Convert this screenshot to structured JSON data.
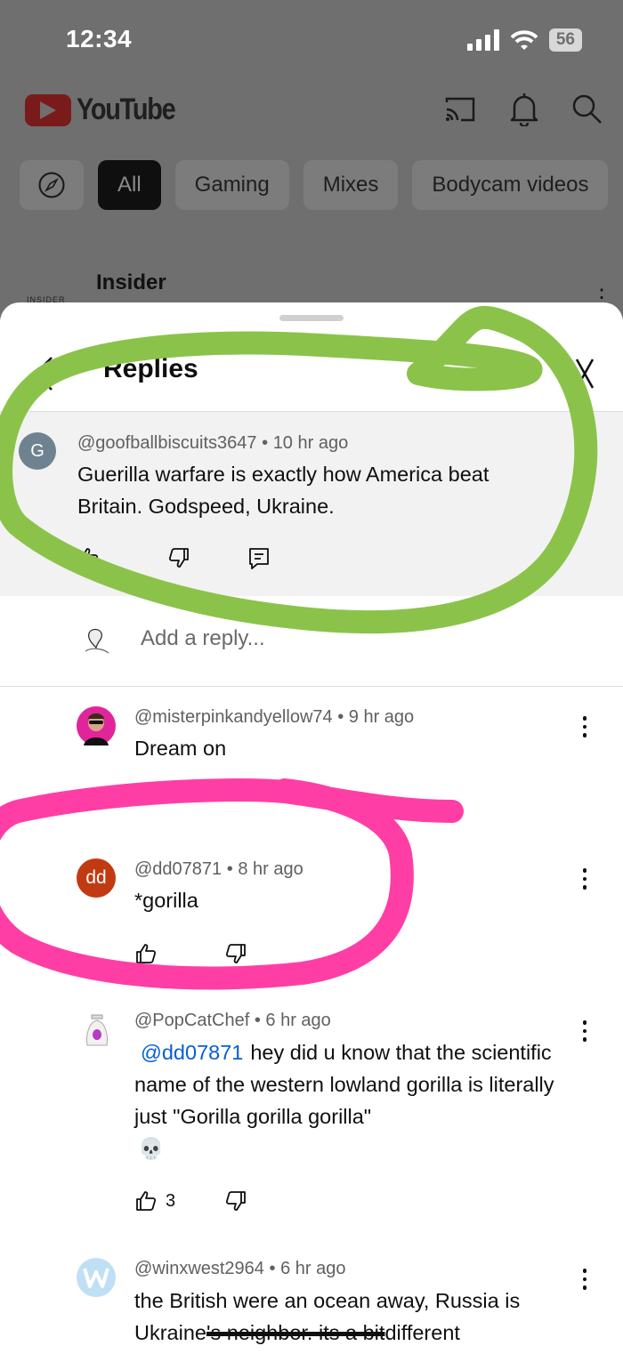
{
  "status": {
    "time": "12:34",
    "battery": "56"
  },
  "app": {
    "logo_text": "YouTube",
    "chips": [
      "All",
      "Gaming",
      "Mixes",
      "Bodycam videos"
    ],
    "video_channel": "Insider",
    "channel_logo_text": "INSIDER"
  },
  "sheet": {
    "title": "Replies",
    "add_reply_placeholder": "Add a reply..."
  },
  "parent_comment": {
    "avatar_letter": "G",
    "author": "@goofballbiscuits3647",
    "age": "10 hr ago",
    "text": "Guerilla warfare is exactly how America beat Britain. Godspeed, Ukraine."
  },
  "replies": [
    {
      "author": "@misterpinkandyellow74",
      "age": "9 hr ago",
      "text": "Dream on"
    },
    {
      "avatar_text": "dd",
      "author": "@dd07871",
      "age": "8 hr ago",
      "text": "*gorilla"
    },
    {
      "author": "@PopCatChef",
      "age": "6 hr ago",
      "mention": "@dd07871",
      "text": "hey did u know that the scientific name of the western lowland gorilla is literally just \"Gorilla gorilla gorilla\"",
      "emoji": "💀",
      "likes": "3"
    },
    {
      "author": "@winxwest2964",
      "age": "6 hr ago",
      "text_line1": "the British were an ocean away, Russia is",
      "text_line2_start": "Ukraine",
      "text_line2_struck": "'s neighbor. its a bit",
      "text_line2_end": "different"
    }
  ],
  "separator": "•",
  "colors": {
    "annotation_green": "#8bc34a",
    "annotation_pink": "#ff3ea5",
    "dd_avatar": "#c23a12",
    "parent_avatar": "#6f8290"
  }
}
